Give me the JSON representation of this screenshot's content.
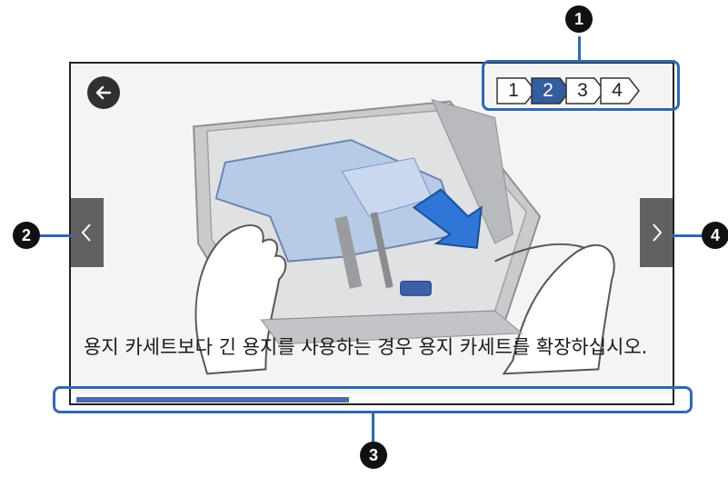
{
  "screen": {
    "message": "용지 카세트보다 긴 용지를 사용하는 경우 용지 카세트를 확장하십시오.",
    "progress": 0.46,
    "steps": [
      {
        "label": "1",
        "active": false
      },
      {
        "label": "2",
        "active": true
      },
      {
        "label": "3",
        "active": false
      },
      {
        "label": "4",
        "active": false
      }
    ]
  },
  "callouts": {
    "c1": "1",
    "c2": "2",
    "c3": "3",
    "c4": "4"
  },
  "colors": {
    "accent": "#2f69b2",
    "step_active": "#345d9d",
    "progress": "#4b6ba8",
    "nav": "#616161"
  },
  "icons": {
    "back": "arrow-left-icon",
    "prev": "chevron-left-icon",
    "next": "chevron-right-icon"
  }
}
